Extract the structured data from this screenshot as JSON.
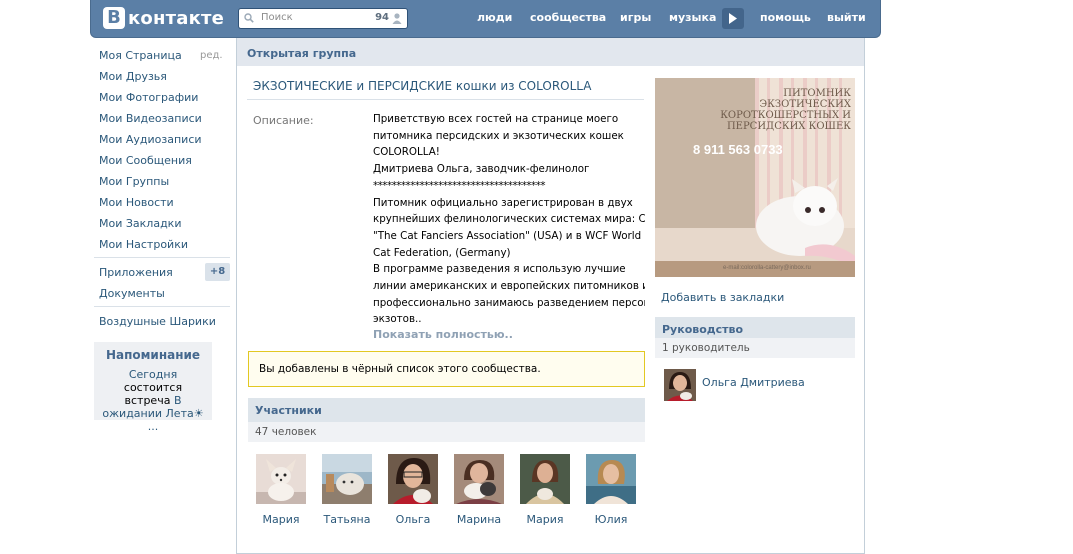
{
  "header": {
    "logo_letter": "В",
    "logo_word": "контакте",
    "search_placeholder": "Поиск",
    "search_count": "94",
    "nav": [
      "люди",
      "сообщества",
      "игры",
      "музыка",
      "помощь",
      "выйти"
    ]
  },
  "sidebar": {
    "edit_label": "ред.",
    "items": [
      "Моя Страница",
      "Мои Друзья",
      "Мои Фотографии",
      "Мои Видеозаписи",
      "Мои Аудиозаписи",
      "Мои Сообщения",
      "Мои Группы",
      "Мои Новости",
      "Мои Закладки",
      "Мои Настройки"
    ],
    "apps_label": "Приложения",
    "apps_badge": "+8",
    "docs_label": "Документы",
    "balloons_label": "Воздушные Шарики",
    "reminder": {
      "title": "Напоминание",
      "today": "Сегодня",
      "text1": " состоится",
      "text2": "встреча ",
      "event": "В ожидании Лета☀ ..."
    }
  },
  "main": {
    "breadcrumb": "Открытая группа",
    "group_title": "ЭКЗОТИЧЕСКИЕ и ПЕРСИДСКИЕ кошки из COLOROLLA",
    "description_label": "Описание:",
    "description_lines": [
      "Приветствую всех гостей на странице моего",
      "питомника персидских и экзотических кошек",
      "COLOROLLA!",
      "Дмитриева Ольга, заводчик-фелинолог",
      "*************************************",
      "Питомник официально зарегистрирован в двух",
      "крупнейших фелинологических системах мира: CFA",
      "\"The Cat Fanciers Association\" (USA) и в WCF World",
      "Cat Federation, (Germany)",
      "В программе разведения я использую лучшие",
      "линии американских и европейских питомников и",
      "профессионально занимаюсь разведением персов и",
      "экзотов.."
    ],
    "show_more": "Показать полностью..",
    "notice": "Вы добавлены в чёрный список этого сообщества.",
    "members_title": "Участники",
    "members_count": "47 человек",
    "members": [
      "Мария",
      "Татьяна",
      "Ольга",
      "Марина",
      "Мария",
      "Юлия"
    ]
  },
  "right": {
    "poster": {
      "line1": "ПИТОМНИК",
      "line2": "ЭКЗОТИЧЕСКИХ",
      "line3": "КОРОТКОШЕРСТНЫХ И",
      "line4": "ПЕРСИДСКИХ КОШЕК",
      "phone": "8 911 563 0733",
      "email": "e-mail:colorolla-cattery@inbox.ru"
    },
    "bookmark": "Добавить в закладки",
    "leaders_title": "Руководство",
    "leaders_count": "1 руководитель",
    "leader_name": "Ольга Дмитриева"
  }
}
